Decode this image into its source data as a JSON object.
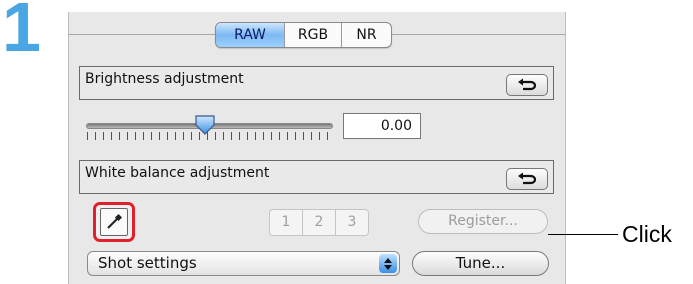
{
  "step_number": "1",
  "tabs": [
    {
      "label": "RAW",
      "active": true
    },
    {
      "label": "RGB",
      "active": false
    },
    {
      "label": "NR",
      "active": false
    }
  ],
  "brightness": {
    "label": "Brightness adjustment",
    "reset_icon": "undo-arrow-icon",
    "slider_fraction": 0.48,
    "value": "0.00"
  },
  "white_balance": {
    "label": "White balance adjustment",
    "reset_icon": "undo-arrow-icon",
    "eyedropper_icon": "eyedropper-icon",
    "custom_buttons": [
      "1",
      "2",
      "3"
    ],
    "register_label": "Register...",
    "select_value": "Shot settings",
    "tune_label": "Tune..."
  },
  "callout": {
    "text": "Click"
  },
  "colors": {
    "step_number": "#4aa6e3",
    "highlight": "#e0202a",
    "active_tab": "#7db9f2"
  }
}
